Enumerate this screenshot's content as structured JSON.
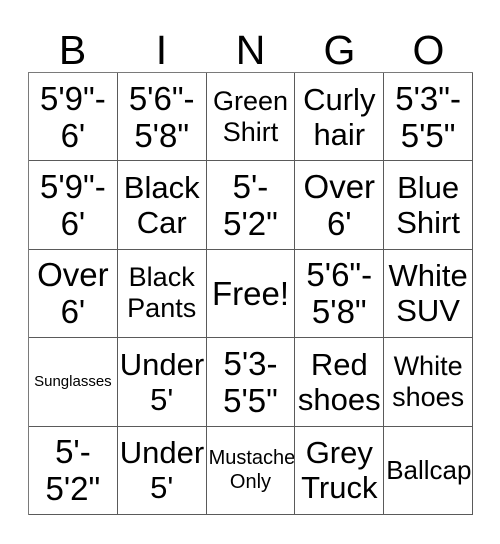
{
  "card": {
    "title": "BINGO",
    "header_letters": [
      "B",
      "I",
      "N",
      "G",
      "O"
    ],
    "free_space_label": "Free!",
    "border_color": "#5a5a5a",
    "text_color": "#000000",
    "background_color": "#ffffff",
    "rows": [
      [
        {
          "text": "5'9\"-\n6'",
          "size": "fs-xl"
        },
        {
          "text": "5'6\"-\n5'8\"",
          "size": "fs-xl"
        },
        {
          "text": "Green\nShirt",
          "size": "fs-md"
        },
        {
          "text": "Curly\nhair",
          "size": "fs-lg"
        },
        {
          "text": "5'3\"-\n5'5\"",
          "size": "fs-xl"
        }
      ],
      [
        {
          "text": "5'9\"-\n6'",
          "size": "fs-xl"
        },
        {
          "text": "Black\nCar",
          "size": "fs-lg"
        },
        {
          "text": "5'-\n5'2\"",
          "size": "fs-xl"
        },
        {
          "text": "Over\n6'",
          "size": "fs-xl"
        },
        {
          "text": "Blue\nShirt",
          "size": "fs-lg"
        }
      ],
      [
        {
          "text": "Over\n6'",
          "size": "fs-xl"
        },
        {
          "text": "Black\nPants",
          "size": "fs-md"
        },
        {
          "text": "Free!",
          "size": "fs-xl"
        },
        {
          "text": "5'6\"-\n5'8\"",
          "size": "fs-xl"
        },
        {
          "text": "White\nSUV",
          "size": "fs-lg"
        }
      ],
      [
        {
          "text": "Sunglasses",
          "size": "fs-xxs"
        },
        {
          "text": "Under\n5'",
          "size": "fs-lg"
        },
        {
          "text": "5'3-\n5'5\"",
          "size": "fs-xl"
        },
        {
          "text": "Red\nshoes",
          "size": "fs-lg"
        },
        {
          "text": "White\nshoes",
          "size": "fs-md"
        }
      ],
      [
        {
          "text": "5'-\n5'2\"",
          "size": "fs-xl"
        },
        {
          "text": "Under\n5'",
          "size": "fs-lg"
        },
        {
          "text": "Mustache\nOnly",
          "size": "fs-xs"
        },
        {
          "text": "Grey\nTruck",
          "size": "fs-lg"
        },
        {
          "text": "Ballcap",
          "size": "fs-sm"
        }
      ]
    ]
  }
}
